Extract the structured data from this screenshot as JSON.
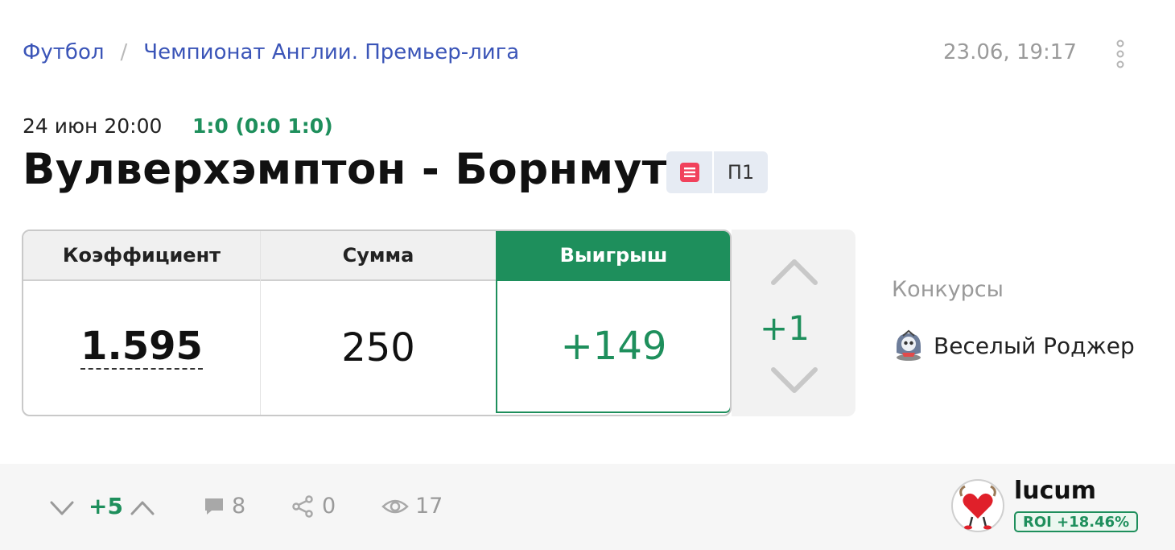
{
  "breadcrumb": {
    "sport": "Футбол",
    "separator": "/",
    "league": "Чемпионат Англии. Премьер-лига"
  },
  "post": {
    "timestamp": "23.06, 19:17",
    "more_icon": "vertical-dots-icon"
  },
  "match": {
    "date": "24 июн 20:00",
    "score": "1:0 (0:0 1:0)",
    "title": "Вулверхэмптон - Борнмут",
    "note_icon": "document-icon",
    "outcome": "П1"
  },
  "bet": {
    "coef_label": "Коэффициент",
    "stake_label": "Сумма",
    "win_label": "Выигрыш",
    "coef": "1.595",
    "stake": "250",
    "win": "+149"
  },
  "vote": {
    "count": "+1",
    "up_icon": "chevron-up-icon",
    "down_icon": "chevron-down-icon"
  },
  "contests": {
    "label": "Конкурсы",
    "items": [
      {
        "name": "Веселый Роджер",
        "icon": "trophy-skull-icon"
      }
    ]
  },
  "footer": {
    "rating": "+5",
    "comments": "8",
    "shares": "0",
    "views": "17"
  },
  "author": {
    "username": "lucum",
    "roi": "ROI +18.46%"
  },
  "colors": {
    "accent_green": "#1e8f5c",
    "link_blue": "#3b55b8",
    "muted": "#9a9a9a"
  }
}
